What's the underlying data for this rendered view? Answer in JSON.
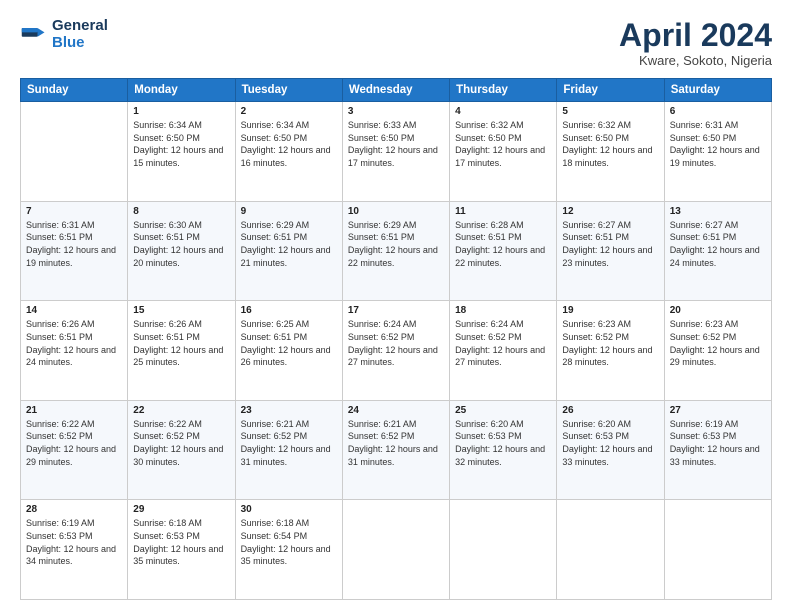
{
  "header": {
    "logo_line1": "General",
    "logo_line2": "Blue",
    "title": "April 2024",
    "location": "Kware, Sokoto, Nigeria"
  },
  "days_of_week": [
    "Sunday",
    "Monday",
    "Tuesday",
    "Wednesday",
    "Thursday",
    "Friday",
    "Saturday"
  ],
  "weeks": [
    [
      {
        "day": "",
        "sunrise": "",
        "sunset": "",
        "daylight": ""
      },
      {
        "day": "1",
        "sunrise": "Sunrise: 6:34 AM",
        "sunset": "Sunset: 6:50 PM",
        "daylight": "Daylight: 12 hours and 15 minutes."
      },
      {
        "day": "2",
        "sunrise": "Sunrise: 6:34 AM",
        "sunset": "Sunset: 6:50 PM",
        "daylight": "Daylight: 12 hours and 16 minutes."
      },
      {
        "day": "3",
        "sunrise": "Sunrise: 6:33 AM",
        "sunset": "Sunset: 6:50 PM",
        "daylight": "Daylight: 12 hours and 17 minutes."
      },
      {
        "day": "4",
        "sunrise": "Sunrise: 6:32 AM",
        "sunset": "Sunset: 6:50 PM",
        "daylight": "Daylight: 12 hours and 17 minutes."
      },
      {
        "day": "5",
        "sunrise": "Sunrise: 6:32 AM",
        "sunset": "Sunset: 6:50 PM",
        "daylight": "Daylight: 12 hours and 18 minutes."
      },
      {
        "day": "6",
        "sunrise": "Sunrise: 6:31 AM",
        "sunset": "Sunset: 6:50 PM",
        "daylight": "Daylight: 12 hours and 19 minutes."
      }
    ],
    [
      {
        "day": "7",
        "sunrise": "Sunrise: 6:31 AM",
        "sunset": "Sunset: 6:51 PM",
        "daylight": "Daylight: 12 hours and 19 minutes."
      },
      {
        "day": "8",
        "sunrise": "Sunrise: 6:30 AM",
        "sunset": "Sunset: 6:51 PM",
        "daylight": "Daylight: 12 hours and 20 minutes."
      },
      {
        "day": "9",
        "sunrise": "Sunrise: 6:29 AM",
        "sunset": "Sunset: 6:51 PM",
        "daylight": "Daylight: 12 hours and 21 minutes."
      },
      {
        "day": "10",
        "sunrise": "Sunrise: 6:29 AM",
        "sunset": "Sunset: 6:51 PM",
        "daylight": "Daylight: 12 hours and 22 minutes."
      },
      {
        "day": "11",
        "sunrise": "Sunrise: 6:28 AM",
        "sunset": "Sunset: 6:51 PM",
        "daylight": "Daylight: 12 hours and 22 minutes."
      },
      {
        "day": "12",
        "sunrise": "Sunrise: 6:27 AM",
        "sunset": "Sunset: 6:51 PM",
        "daylight": "Daylight: 12 hours and 23 minutes."
      },
      {
        "day": "13",
        "sunrise": "Sunrise: 6:27 AM",
        "sunset": "Sunset: 6:51 PM",
        "daylight": "Daylight: 12 hours and 24 minutes."
      }
    ],
    [
      {
        "day": "14",
        "sunrise": "Sunrise: 6:26 AM",
        "sunset": "Sunset: 6:51 PM",
        "daylight": "Daylight: 12 hours and 24 minutes."
      },
      {
        "day": "15",
        "sunrise": "Sunrise: 6:26 AM",
        "sunset": "Sunset: 6:51 PM",
        "daylight": "Daylight: 12 hours and 25 minutes."
      },
      {
        "day": "16",
        "sunrise": "Sunrise: 6:25 AM",
        "sunset": "Sunset: 6:51 PM",
        "daylight": "Daylight: 12 hours and 26 minutes."
      },
      {
        "day": "17",
        "sunrise": "Sunrise: 6:24 AM",
        "sunset": "Sunset: 6:52 PM",
        "daylight": "Daylight: 12 hours and 27 minutes."
      },
      {
        "day": "18",
        "sunrise": "Sunrise: 6:24 AM",
        "sunset": "Sunset: 6:52 PM",
        "daylight": "Daylight: 12 hours and 27 minutes."
      },
      {
        "day": "19",
        "sunrise": "Sunrise: 6:23 AM",
        "sunset": "Sunset: 6:52 PM",
        "daylight": "Daylight: 12 hours and 28 minutes."
      },
      {
        "day": "20",
        "sunrise": "Sunrise: 6:23 AM",
        "sunset": "Sunset: 6:52 PM",
        "daylight": "Daylight: 12 hours and 29 minutes."
      }
    ],
    [
      {
        "day": "21",
        "sunrise": "Sunrise: 6:22 AM",
        "sunset": "Sunset: 6:52 PM",
        "daylight": "Daylight: 12 hours and 29 minutes."
      },
      {
        "day": "22",
        "sunrise": "Sunrise: 6:22 AM",
        "sunset": "Sunset: 6:52 PM",
        "daylight": "Daylight: 12 hours and 30 minutes."
      },
      {
        "day": "23",
        "sunrise": "Sunrise: 6:21 AM",
        "sunset": "Sunset: 6:52 PM",
        "daylight": "Daylight: 12 hours and 31 minutes."
      },
      {
        "day": "24",
        "sunrise": "Sunrise: 6:21 AM",
        "sunset": "Sunset: 6:52 PM",
        "daylight": "Daylight: 12 hours and 31 minutes."
      },
      {
        "day": "25",
        "sunrise": "Sunrise: 6:20 AM",
        "sunset": "Sunset: 6:53 PM",
        "daylight": "Daylight: 12 hours and 32 minutes."
      },
      {
        "day": "26",
        "sunrise": "Sunrise: 6:20 AM",
        "sunset": "Sunset: 6:53 PM",
        "daylight": "Daylight: 12 hours and 33 minutes."
      },
      {
        "day": "27",
        "sunrise": "Sunrise: 6:19 AM",
        "sunset": "Sunset: 6:53 PM",
        "daylight": "Daylight: 12 hours and 33 minutes."
      }
    ],
    [
      {
        "day": "28",
        "sunrise": "Sunrise: 6:19 AM",
        "sunset": "Sunset: 6:53 PM",
        "daylight": "Daylight: 12 hours and 34 minutes."
      },
      {
        "day": "29",
        "sunrise": "Sunrise: 6:18 AM",
        "sunset": "Sunset: 6:53 PM",
        "daylight": "Daylight: 12 hours and 35 minutes."
      },
      {
        "day": "30",
        "sunrise": "Sunrise: 6:18 AM",
        "sunset": "Sunset: 6:54 PM",
        "daylight": "Daylight: 12 hours and 35 minutes."
      },
      {
        "day": "",
        "sunrise": "",
        "sunset": "",
        "daylight": ""
      },
      {
        "day": "",
        "sunrise": "",
        "sunset": "",
        "daylight": ""
      },
      {
        "day": "",
        "sunrise": "",
        "sunset": "",
        "daylight": ""
      },
      {
        "day": "",
        "sunrise": "",
        "sunset": "",
        "daylight": ""
      }
    ]
  ]
}
